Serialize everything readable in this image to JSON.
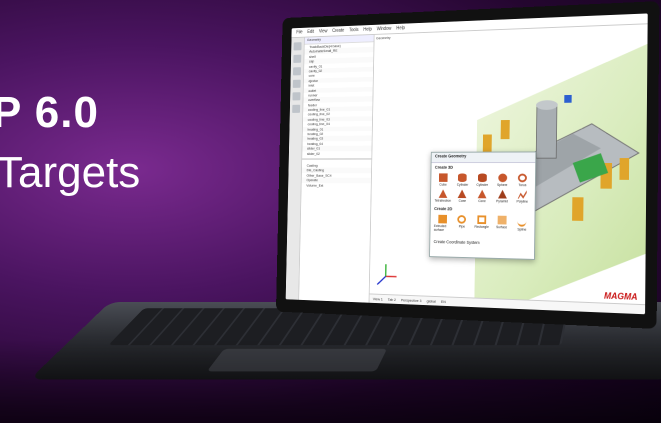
{
  "hero": {
    "headline": "P 6.0",
    "subline": "Targets"
  },
  "app": {
    "menu": [
      "File",
      "Edit",
      "View",
      "Create",
      "Tools",
      "Help",
      "Window",
      "Help"
    ],
    "tree_header": "Geometry",
    "tree_rows": [
      "TrackBackDie(4 base)",
      "AutomaticSmall_RE",
      "shell",
      "cap",
      "cavity_01",
      "cavity_02",
      "core",
      "ejector",
      "inlet",
      "outlet",
      "runner",
      "overflow",
      "feeder",
      "cooling_line_01",
      "cooling_line_02",
      "cooling_line_03",
      "cooling_line_04",
      "heating_01",
      "heating_02",
      "heating_03",
      "heating_04",
      "slider_01",
      "slider_02"
    ],
    "lower_panel_rows": [
      "Casting",
      "Die_Casting",
      "Other_Base_SC4",
      "Operate",
      "Volume_Ext"
    ],
    "viewport_title": "Geometry",
    "dialog": {
      "title": "Create Geometry",
      "section_3d": "Create 3D",
      "shapes_3d": [
        "Cube",
        "Cylinder",
        "Cylinder",
        "Sphere",
        "Torus",
        "Tetrahedron",
        "Cone",
        "Cone",
        "Pyramid",
        "Polyline"
      ],
      "section_2d": "Create 2D",
      "shapes_2d": [
        "Extruded surface",
        "Pipe",
        "Rectangle",
        "Surface",
        "Spline"
      ],
      "footer": "Create Coordinate System"
    },
    "status_items": [
      "View 1",
      "Tab 2",
      "Perspective 3",
      "global",
      "EN"
    ],
    "brand": "MAGMA"
  },
  "colors": {
    "accent": "#c91616",
    "background": "#4a1460",
    "part_yellow": "#e0a52b",
    "part_gray": "#9ea4a8",
    "floor_green": "#d9ecbd"
  }
}
